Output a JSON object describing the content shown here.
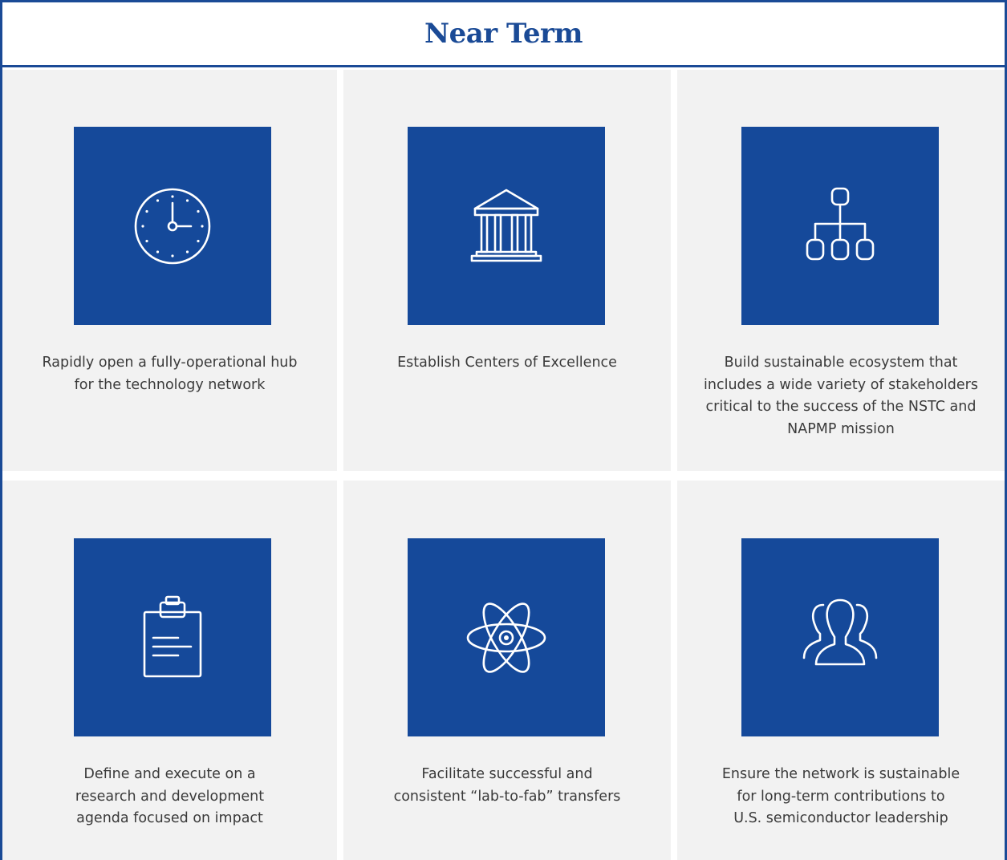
{
  "header": {
    "title": "Near Term"
  },
  "items": [
    {
      "icon": "clock-icon",
      "lines": [
        "Rapidly open a fully-operational hub",
        "for the technology network"
      ]
    },
    {
      "icon": "bank-building-icon",
      "lines": [
        "Establish Centers of Excellence"
      ]
    },
    {
      "icon": "org-chart-icon",
      "lines": [
        "Build sustainable ecosystem that",
        "includes a wide variety of stakeholders",
        "critical to the success of the NSTC and",
        "NAPMP mission"
      ]
    },
    {
      "icon": "clipboard-icon",
      "lines": [
        "Define and execute on a",
        "research and development",
        "agenda focused on impact"
      ]
    },
    {
      "icon": "atom-icon",
      "lines": [
        "Facilitate successful and",
        "consistent “lab-to-fab” transfers"
      ]
    },
    {
      "icon": "people-group-icon",
      "lines": [
        "Ensure the network is sustainable",
        "for long-term contributions to",
        "U.S. semiconductor leadership"
      ]
    }
  ],
  "colors": {
    "brand_blue": "#15499a",
    "header_text": "#1a4a96",
    "cell_bg": "#f2f2f2",
    "caption_text": "#3a3a3a"
  }
}
